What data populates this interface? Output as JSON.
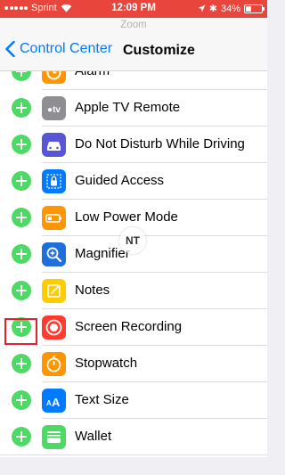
{
  "status_bar": {
    "carrier": "Sprint",
    "time": "12:09 PM",
    "battery_percent": "34%",
    "battery_level": 0.34,
    "background_color": "#e8453c"
  },
  "zoom_label": "Zoom",
  "nav": {
    "back_label": "Control Center",
    "title": "Customize"
  },
  "items": [
    {
      "label": "Alarm",
      "icon": "alarm-clock-icon",
      "color": "#ff9500"
    },
    {
      "label": "Apple TV Remote",
      "icon": "apple-tv-icon",
      "color": "#8e8e93"
    },
    {
      "label": "Do Not Disturb While Driving",
      "icon": "car-icon",
      "color": "#5856d6"
    },
    {
      "label": "Guided Access",
      "icon": "lock-icon",
      "color": "#007aff"
    },
    {
      "label": "Low Power Mode",
      "icon": "battery-icon",
      "color": "#ff9500"
    },
    {
      "label": "Magnifier",
      "icon": "magnifier-icon",
      "color": "#1e6fd9"
    },
    {
      "label": "Notes",
      "icon": "notes-icon",
      "color": "#ffcc00"
    },
    {
      "label": "Screen Recording",
      "icon": "record-icon",
      "color": "#ff3b30"
    },
    {
      "label": "Stopwatch",
      "icon": "stopwatch-icon",
      "color": "#ff9500"
    },
    {
      "label": "Text Size",
      "icon": "text-size-icon",
      "color": "#007aff"
    },
    {
      "label": "Wallet",
      "icon": "wallet-icon",
      "color": "#4cd964"
    }
  ],
  "watermark_text": "NT"
}
